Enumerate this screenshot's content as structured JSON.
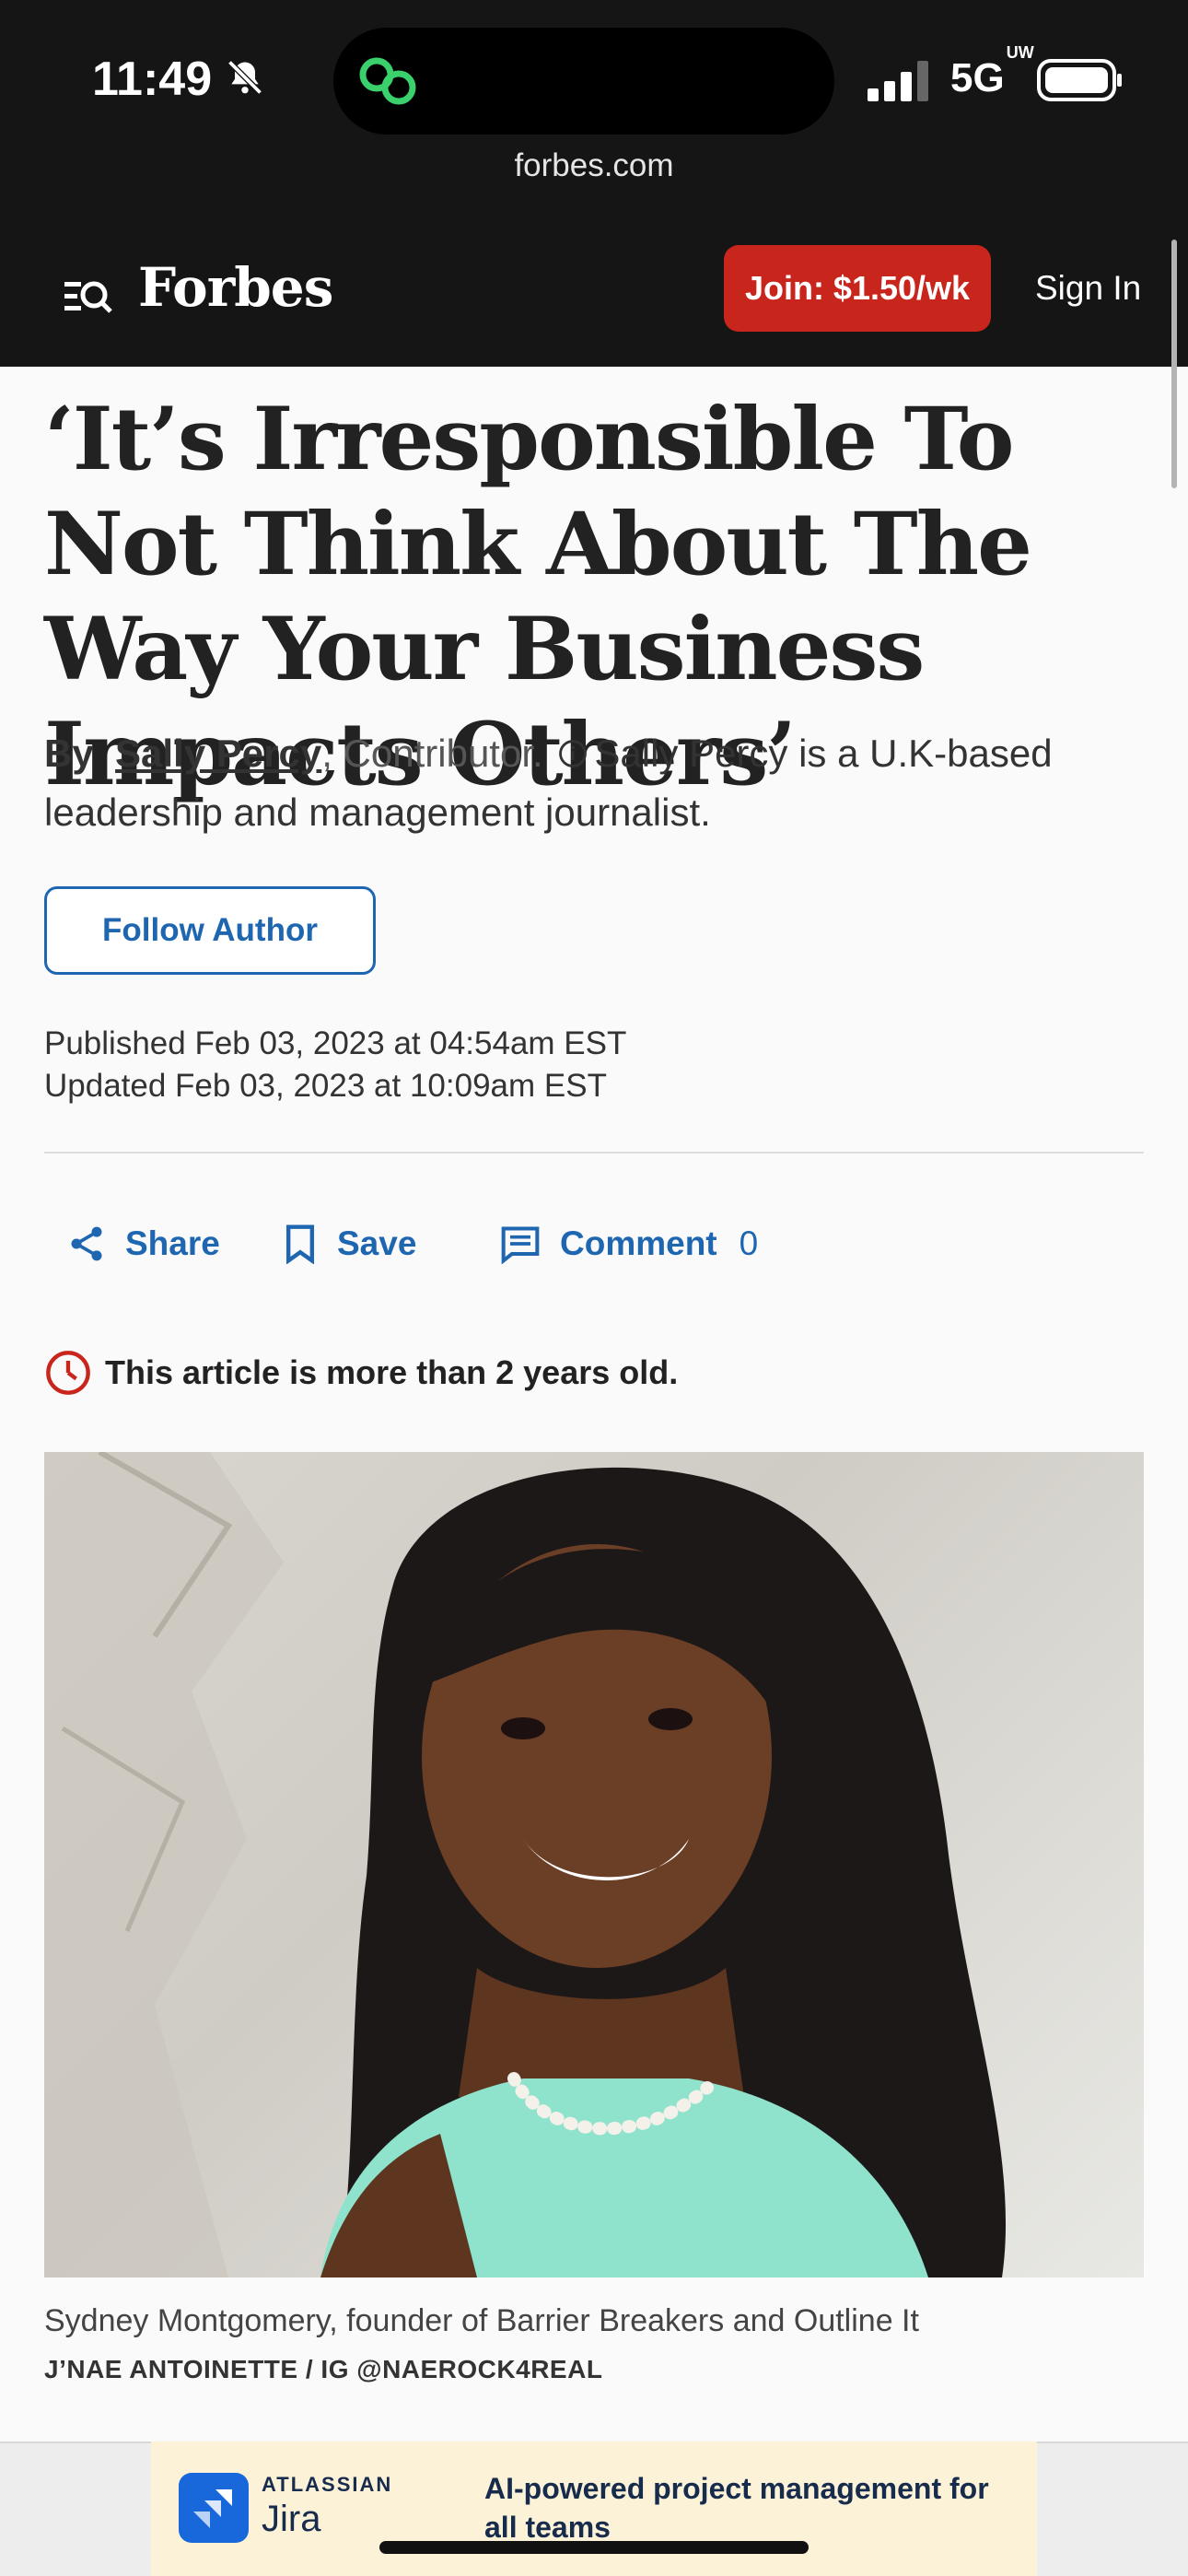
{
  "status_bar": {
    "time": "11:49",
    "network": "5G",
    "network_suffix": "UW",
    "url": "forbes.com",
    "icons": [
      "bell-slash-icon",
      "link-icon",
      "signal-icon",
      "battery-icon"
    ]
  },
  "header": {
    "logo": "Forbes",
    "join_label": "Join: $1.50/wk",
    "signin_label": "Sign In",
    "join_color": "#c8251c"
  },
  "article": {
    "headline": "‘It’s Irresponsible To Not Think About The Way Your Business Impacts Others’",
    "byline": {
      "by": "By",
      "author": "Sally Percy",
      "role": ", Contributor.",
      "bio": "Sally Percy is a U.K-based leadership and management journalist."
    },
    "follow_label": "Follow Author",
    "published": "Published Feb 03, 2023 at 04:54am EST",
    "updated": "Updated Feb 03, 2023 at 10:09am EST",
    "actions": {
      "share": "Share",
      "save": "Save",
      "comment": "Comment",
      "comment_count": "0"
    },
    "age_notice": "This article is more than 2 years old.",
    "caption": "Sydney Montgomery, founder of Barrier Breakers and Outline It",
    "credit": "J’NAE ANTOINETTE / IG @NAEROCK4REAL"
  },
  "ad": {
    "brand": "ATLASSIAN",
    "product": "Jira",
    "text": "AI-powered project management for all teams"
  },
  "colors": {
    "accent_blue": "#1f66b1",
    "dark_bg": "#151515",
    "alert_red": "#c8251c"
  }
}
